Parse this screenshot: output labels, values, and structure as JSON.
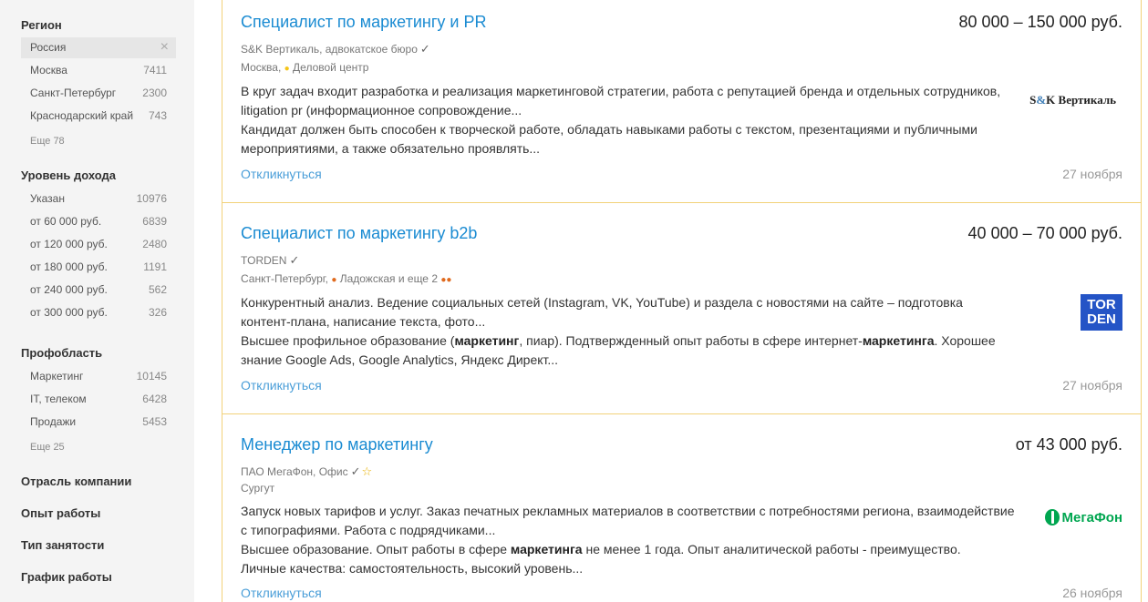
{
  "sidebar": {
    "region": {
      "title": "Регион",
      "items": [
        {
          "label": "Россия",
          "count": ""
        },
        {
          "label": "Москва",
          "count": "7411"
        },
        {
          "label": "Санкт-Петербург",
          "count": "2300"
        },
        {
          "label": "Краснодарский край",
          "count": "743"
        }
      ],
      "more": "Еще 78"
    },
    "income": {
      "title": "Уровень дохода",
      "items": [
        {
          "label": "Указан",
          "count": "10976"
        },
        {
          "label": "от 60 000 руб.",
          "count": "6839"
        },
        {
          "label": "от 120 000 руб.",
          "count": "2480"
        },
        {
          "label": "от 180 000 руб.",
          "count": "1191"
        },
        {
          "label": "от 240 000 руб.",
          "count": "562"
        },
        {
          "label": "от 300 000 руб.",
          "count": "326"
        }
      ]
    },
    "field": {
      "title": "Профобласть",
      "items": [
        {
          "label": "Маркетинг",
          "count": "10145"
        },
        {
          "label": "IT, телеком",
          "count": "6428"
        },
        {
          "label": "Продажи",
          "count": "5453"
        }
      ],
      "more": "Еще 25"
    },
    "industry": {
      "title": "Отрасль компании"
    },
    "experience": {
      "title": "Опыт работы"
    },
    "employment": {
      "title": "Тип занятости"
    },
    "schedule": {
      "title": "График работы"
    }
  },
  "vacancies": [
    {
      "title": "Специалист по маркетингу и PR",
      "salary": "80 000 – 150 000 руб.",
      "company": "S&K Вертикаль, адвокатское бюро",
      "city": "Москва,",
      "metro": "Деловой центр",
      "desc1": "В круг задач входит разработка и реализация маркетинговой стратегии, работа с репутацией бренда и отдельных сотрудников, litigation pr (информационное сопровождение...",
      "desc2": "Кандидат должен быть способен к творческой работе, обладать навыками работы с текстом, презентациями и публичными мероприятиями, а также обязательно проявлять...",
      "apply": "Откликнуться",
      "date": "27 ноября",
      "logo": {
        "sk": "S",
        "amp": "&",
        "k": "K",
        "rest": " Вертикаль"
      }
    },
    {
      "title": "Специалист по маркетингу b2b",
      "salary": "40 000 – 70 000 руб.",
      "company": "TORDEN",
      "city": "Санкт-Петербург,",
      "metro": "Ладожская и еще 2",
      "desc1": "Конкурентный анализ. Ведение социальных сетей (Instagram, VK, YouTube) и раздела с новостями на сайте – подготовка контент-плана, написание текста, фото...",
      "desc2_a": "Высшее профильное образование (",
      "desc2_b": "маркетинг",
      "desc2_c": ", пиар). Подтвержденный опыт работы в сфере интернет-",
      "desc2_d": "маркетинга",
      "desc2_e": ". Хорошее знание Google Ads, Google Analytics, Яндекс Директ...",
      "apply": "Откликнуться",
      "date": "27 ноября",
      "logo": {
        "line1": "TOR",
        "line2": "DEN"
      }
    },
    {
      "title": "Менеджер по маркетингу",
      "salary": "от 43 000 руб.",
      "company": "ПАО МегаФон, Офис",
      "city": "Сургут",
      "desc1": "Запуск новых тарифов и услуг. Заказ печатных рекламных материалов в соответствии с потребностями региона, взаимодействие с типографиями. Работа с подрядчиками...",
      "desc2_a": "Высшее образование. Опыт работы в сфере ",
      "desc2_b": "маркетинга",
      "desc2_c": " не менее 1 года. Опыт аналитической работы - преимущество.",
      "desc3": "Личные качества: самостоятельность, высокий уровень...",
      "apply": "Откликнуться",
      "date": "26 ноября",
      "logo": {
        "text": "МегаФон"
      }
    }
  ],
  "icons": {
    "check": "✓",
    "star": "☆",
    "close": "×",
    "dot": "●"
  },
  "colors": {
    "link": "#1a8bd2",
    "accent_border": "#f2d27a",
    "metro_moscow": "#f5c518",
    "metro_spb": "#e06a1e",
    "megafon": "#00a650",
    "torden": "#2454c6"
  }
}
